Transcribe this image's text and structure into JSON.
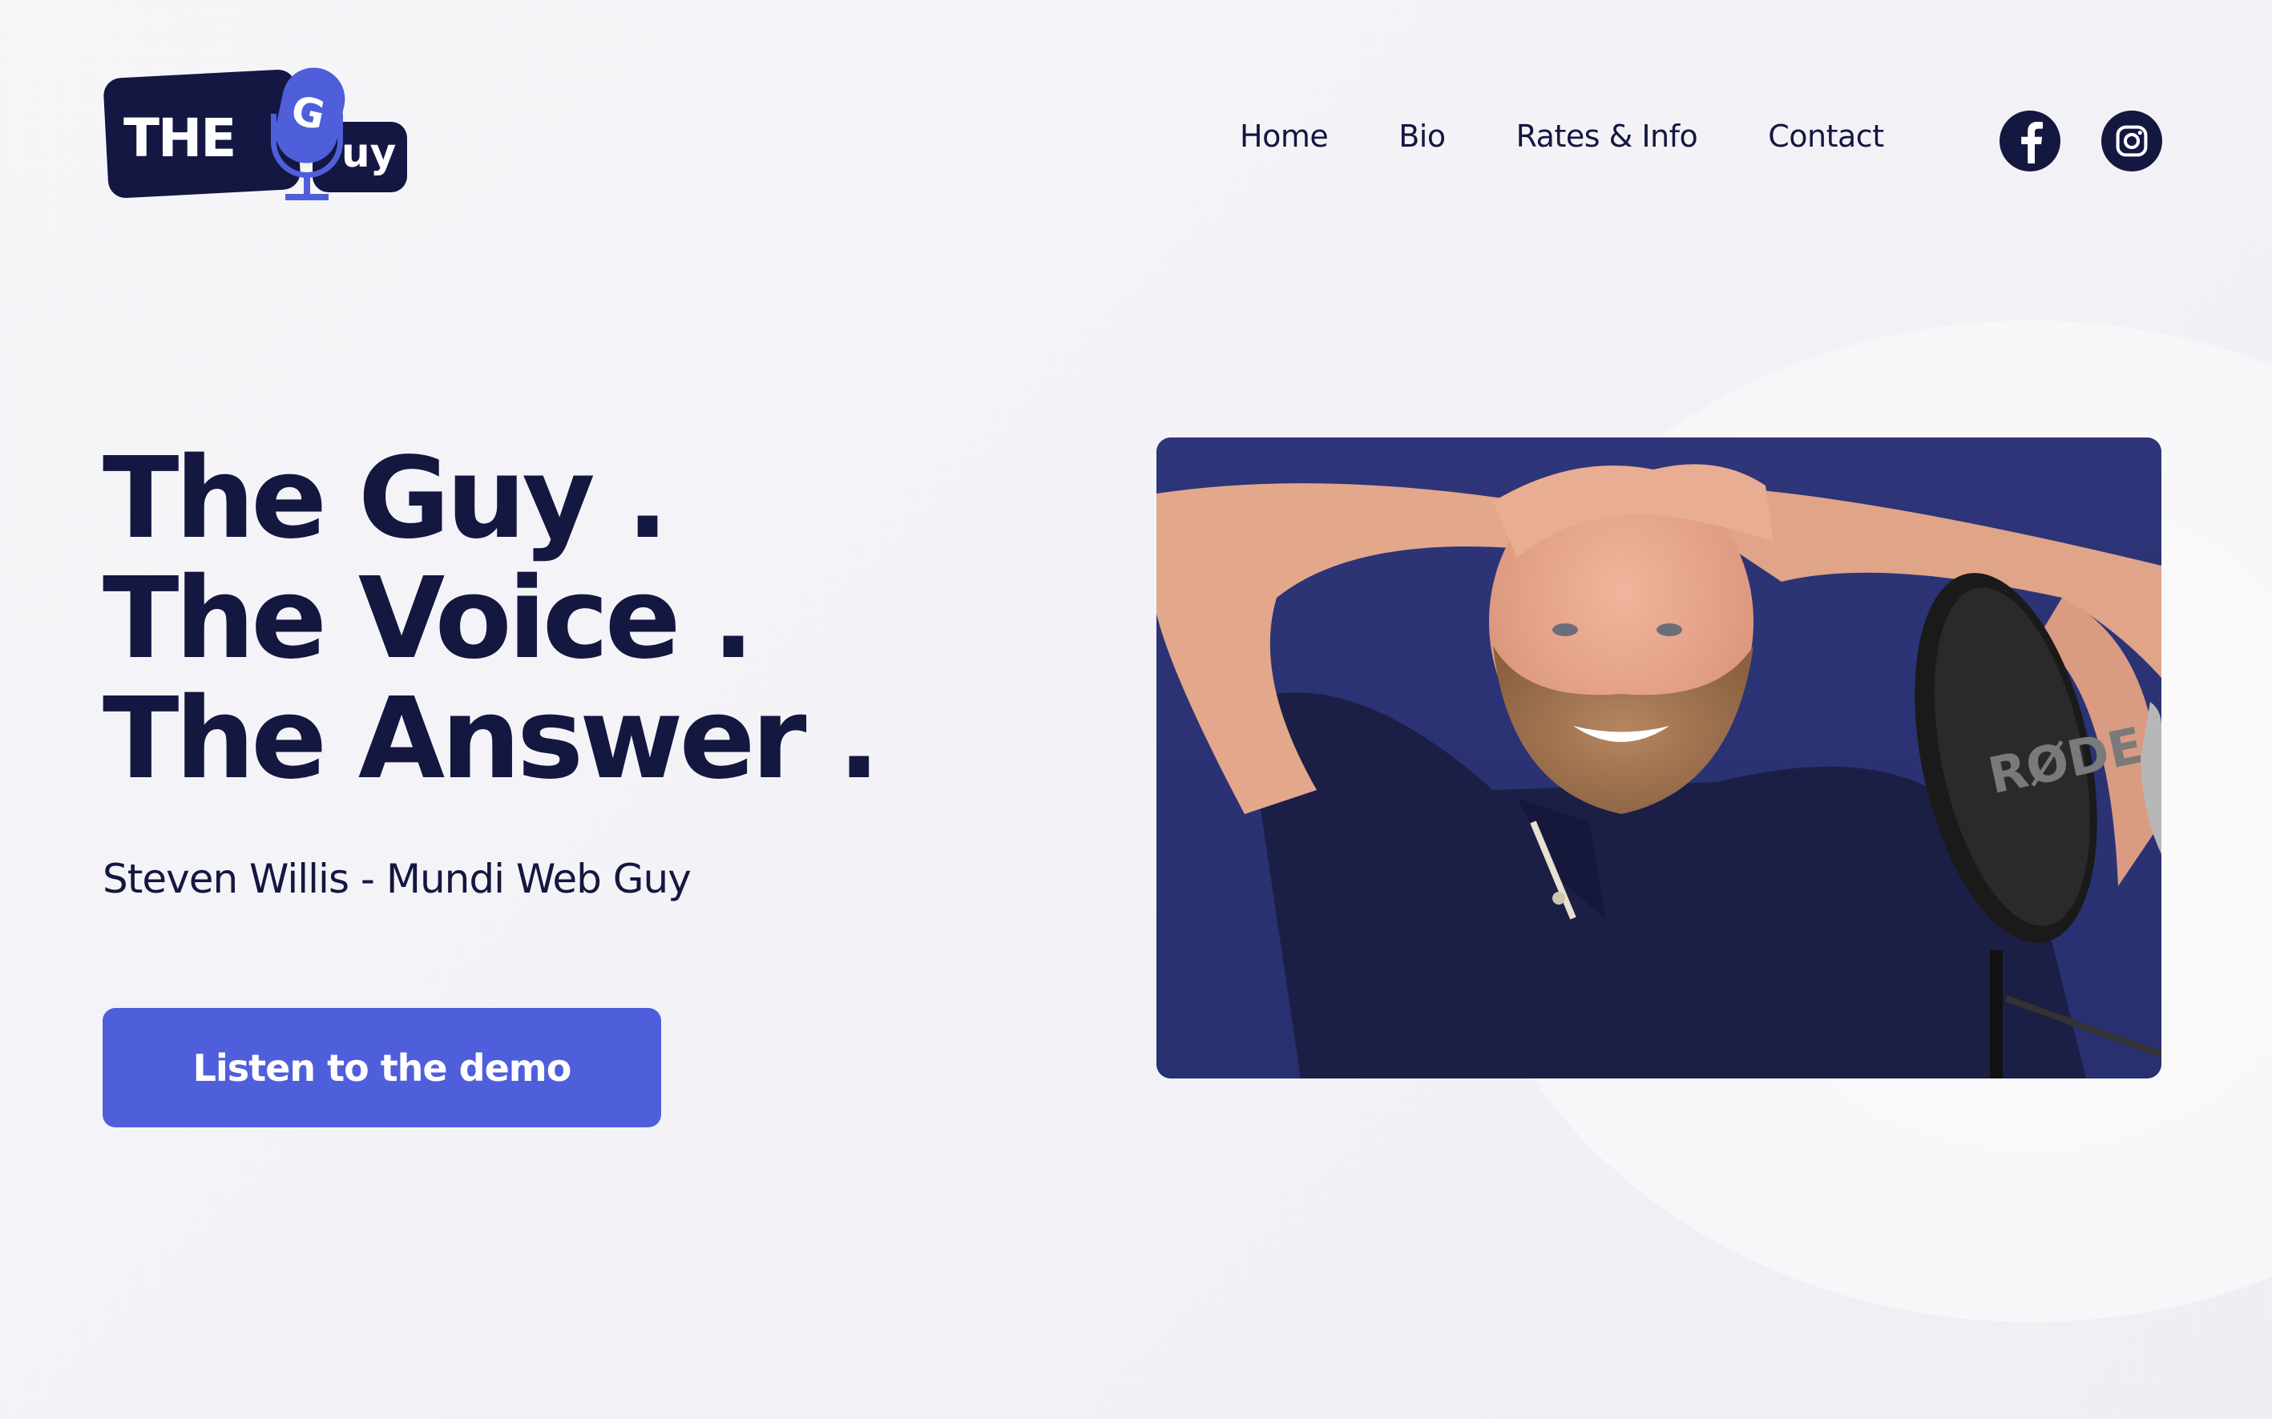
{
  "brand": {
    "logo_text_left": "THE",
    "logo_mic_letter": "G",
    "logo_text_right": "uy",
    "logo_alt": "The Guy logo",
    "colors": {
      "navy": "#14173f",
      "accent": "#4f5fdc",
      "photo_bg": "#2c3478",
      "page_bg": "#f4f4f8"
    }
  },
  "nav": {
    "items": [
      {
        "label": "Home"
      },
      {
        "label": "Bio"
      },
      {
        "label": "Rates & Info"
      },
      {
        "label": "Contact"
      }
    ],
    "social": [
      {
        "name": "facebook",
        "icon": "facebook-icon"
      },
      {
        "name": "instagram",
        "icon": "instagram-icon"
      }
    ]
  },
  "hero": {
    "headline_lines": [
      "The Guy .",
      "The Voice .",
      "The Answer ."
    ],
    "subtitle": "Steven Willis - Mundi Web Guy",
    "cta_label": "Listen to the demo",
    "photo": {
      "alt": "Smiling bald bearded man with hands on head beside a RØDE microphone pop filter",
      "pop_filter_brand": "RØDE"
    }
  }
}
